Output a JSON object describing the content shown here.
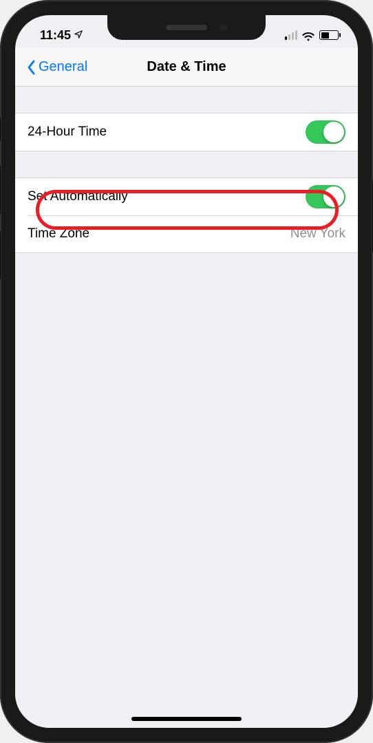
{
  "statusbar": {
    "time": "11:45"
  },
  "nav": {
    "back_label": "General",
    "title": "Date & Time"
  },
  "rows": {
    "hour24": {
      "label": "24-Hour Time",
      "on": true
    },
    "auto": {
      "label": "Set Automatically",
      "on": true
    },
    "zone": {
      "label": "Time Zone",
      "value": "New York"
    }
  },
  "colors": {
    "accent": "#007aff",
    "toggle_on": "#34c759",
    "highlight": "#ec1c24"
  }
}
